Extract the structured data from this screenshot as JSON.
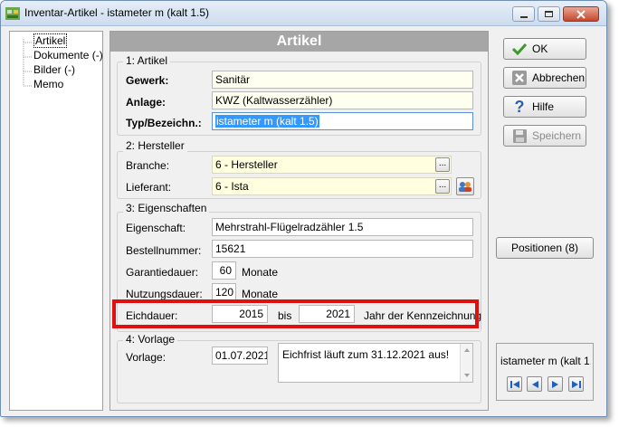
{
  "window": {
    "title": "Inventar-Artikel - istameter m (kalt 1.5)",
    "icon": "app-icon",
    "controls": [
      "minimize-icon",
      "maximize-icon",
      "close-icon"
    ]
  },
  "tree": {
    "items": [
      {
        "label": "Artikel",
        "selected": true
      },
      {
        "label": "Dokumente (-)"
      },
      {
        "label": "Bilder (-)"
      },
      {
        "label": "Memo"
      }
    ]
  },
  "header": {
    "title": "Artikel"
  },
  "artikel_group": {
    "label": "1: Artikel",
    "gewerk_label": "Gewerk:",
    "gewerk_value": "Sanitär",
    "anlage_label": "Anlage:",
    "anlage_value": "KWZ (Kaltwasserzähler)",
    "typ_label": "Typ/Bezeichn.:",
    "typ_value": "istameter m (kalt 1.5)"
  },
  "hersteller_group": {
    "label": "2: Hersteller",
    "branche_label": "Branche:",
    "branche_value": "6 - Hersteller",
    "lieferant_label": "Lieferant:",
    "lieferant_value": "6 - Ista",
    "browse_label": "..."
  },
  "eigenschaften_group": {
    "label": "3: Eigenschaften",
    "eigenschaft_label": "Eigenschaft:",
    "eigenschaft_value": "Mehrstrahl-Flügelradzähler 1.5",
    "bestellnummer_label": "Bestellnummer:",
    "bestellnummer_value": "15621",
    "garantiedauer_label": "Garantiedauer:",
    "garantiedauer_value": "60",
    "garantiedauer_unit": "Monate",
    "nutzungsdauer_label": "Nutzungsdauer:",
    "nutzungsdauer_value": "120",
    "nutzungsdauer_unit": "Monate",
    "eichdauer_label": "Eichdauer:",
    "eichdauer_from": "2015",
    "eichdauer_bis": "bis",
    "eichdauer_to": "2021",
    "eichdauer_suffix": "Jahr der Kennzeichnung"
  },
  "vorlage_group": {
    "label": "4: Vorlage",
    "vorlage_label": "Vorlage:",
    "vorlage_date": "01.07.2021",
    "vorlage_note": "Eichfrist läuft zum 31.12.2021 aus!"
  },
  "buttons": {
    "ok": "OK",
    "abbrechen": "Abbrechen",
    "hilfe": "Hilfe",
    "speichern": "Speichern",
    "positionen": "Positionen (8)"
  },
  "navigator": {
    "current": "istameter m (kalt 1."
  },
  "colors": {
    "highlight_border": "#e01010",
    "header_bg": "#a6a6a6",
    "field_bg": "#fffff0",
    "selection": "#3399ff"
  }
}
